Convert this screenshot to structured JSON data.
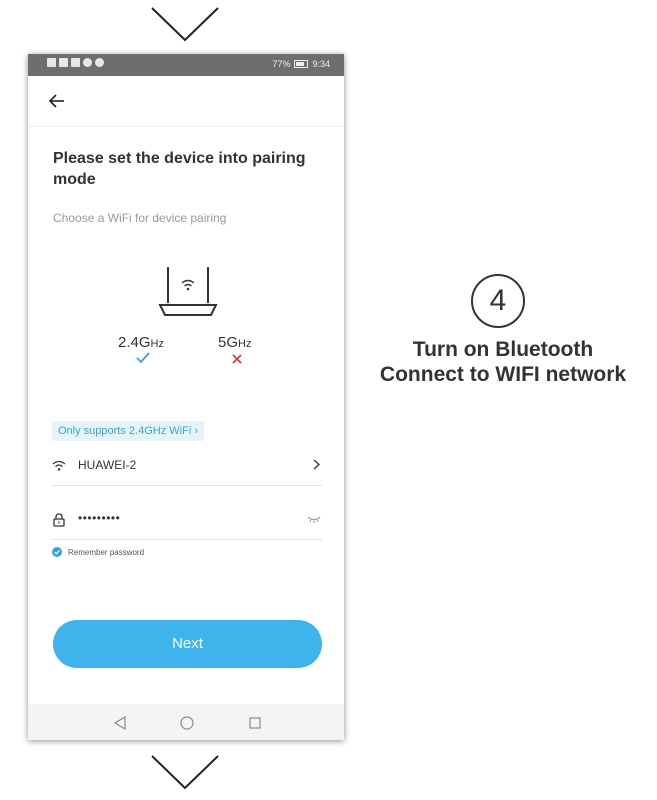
{
  "status_bar": {
    "battery": "77%",
    "time": "9:34"
  },
  "screen": {
    "title": "Please set the device into pairing mode",
    "subtitle": "Choose a WiFi for device pairing",
    "bands": {
      "band_24": {
        "main": "2.4G",
        "unit": "Hz",
        "supported": true
      },
      "band_5": {
        "main": "5G",
        "unit": "Hz",
        "supported": false
      }
    },
    "support_note": "Only supports 2.4GHz WiFi ›",
    "wifi_network": "HUAWEI-2",
    "password_value": "•••••••••",
    "remember_password": "Remember password",
    "next_button": "Next"
  },
  "step": {
    "number": "4",
    "line1": "Turn on Bluetooth",
    "line2": "Connect to WIFI network"
  },
  "colors": {
    "accent": "#3fb3ec",
    "check": "#3aa0d8",
    "cross": "#e53935",
    "note_text": "#36a8c8",
    "note_bg": "#e6f4f8",
    "status_bar": "#6e6e6e"
  },
  "icons": [
    "chevron-down-icon",
    "back-arrow-icon",
    "router-icon",
    "check-icon",
    "cross-icon",
    "wifi-icon",
    "chevron-right-icon",
    "lock-icon",
    "eye-closed-icon",
    "nav-back-icon",
    "nav-home-icon",
    "nav-recent-icon"
  ]
}
